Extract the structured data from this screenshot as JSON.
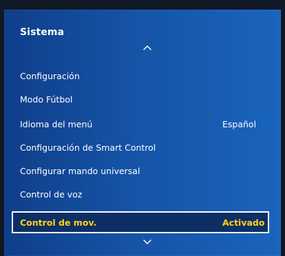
{
  "panel": {
    "title": "Sistema"
  },
  "menu": {
    "items": [
      {
        "label": "Configuración",
        "value": ""
      },
      {
        "label": "Modo Fútbol",
        "value": ""
      },
      {
        "label": "Idioma del menú",
        "value": "Español"
      },
      {
        "label": "Configuración de Smart Control",
        "value": ""
      },
      {
        "label": "Configurar mando universal",
        "value": ""
      },
      {
        "label": "Control de voz",
        "value": ""
      },
      {
        "label": "Control de mov.",
        "value": "Activado",
        "selected": true
      }
    ]
  },
  "icons": {
    "scroll_up": "chevron-up-icon",
    "scroll_down": "chevron-down-icon"
  },
  "colors": {
    "panel_blue": "#1553a6",
    "highlight_text": "#ffd21a",
    "focus_border": "#ffffff"
  }
}
